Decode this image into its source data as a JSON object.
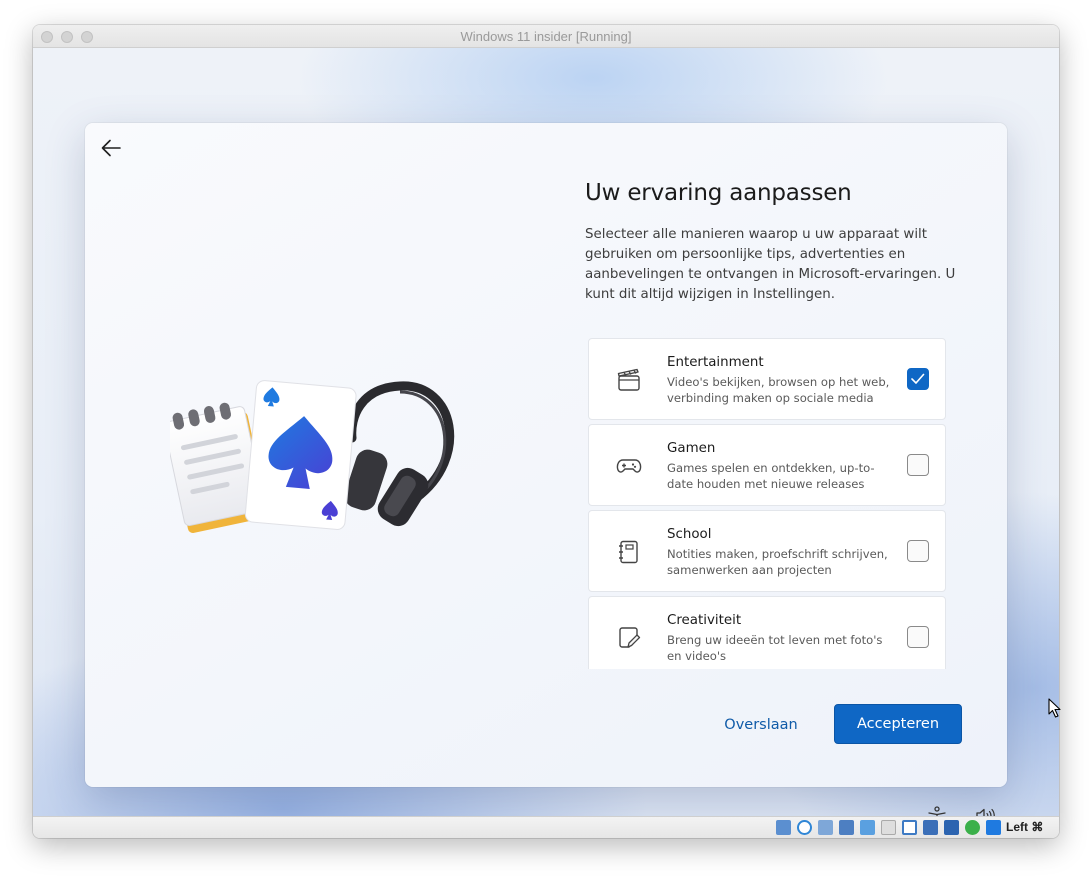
{
  "window": {
    "title": "Windows 11 insider [Running]"
  },
  "oobe": {
    "heading": "Uw ervaring aanpassen",
    "description": "Selecteer alle manieren waarop u uw apparaat wilt gebruiken om persoonlijke tips, advertenties en aanbevelingen te ontvangen in Microsoft-ervaringen. U kunt dit altijd wijzigen in Instellingen.",
    "options": [
      {
        "title": "Entertainment",
        "description": "Video's bekijken, browsen op het web, verbinding maken op sociale media",
        "icon": "clapperboard-icon",
        "checked": true
      },
      {
        "title": "Gamen",
        "description": "Games spelen en ontdekken, up-to-date houden met nieuwe releases",
        "icon": "gamepad-icon",
        "checked": false
      },
      {
        "title": "School",
        "description": "Notities maken, proefschrift schrijven, samenwerken aan projecten",
        "icon": "notebook-icon",
        "checked": false
      },
      {
        "title": "Creativiteit",
        "description": "Breng uw ideeën tot leven met foto's en video's",
        "icon": "sticky-note-pen-icon",
        "checked": false
      }
    ],
    "skip_label": "Overslaan",
    "accept_label": "Accepteren",
    "accent_color": "#0f67c5"
  },
  "statusbar": {
    "host_key": "Left ⌘"
  }
}
